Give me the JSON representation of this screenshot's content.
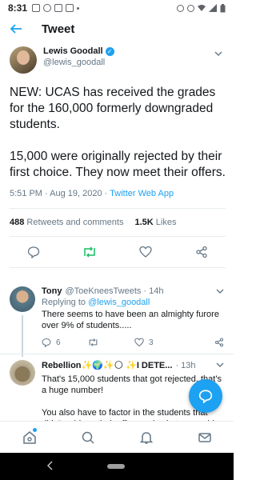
{
  "status_bar": {
    "time": "8:31"
  },
  "app_bar": {
    "title": "Tweet"
  },
  "tweet": {
    "author_name": "Lewis Goodall",
    "author_handle": "@lewis_goodall",
    "text": "NEW: UCAS has received the grades for the 160,000 formerly downgraded students.\n\n15,000 were originally rejected by their first choice. They now meet their offers.",
    "timestamp": "5:51 PM · Aug 19, 2020 · ",
    "source": "Twitter Web App",
    "retweets_count": "488",
    "retweets_label": " Retweets and comments",
    "likes_count": "1.5K",
    "likes_label": " Likes"
  },
  "replies": [
    {
      "name": "Tony",
      "handle": "@ToeKneesTweets",
      "time": "· 14h",
      "replying_prefix": "Replying to ",
      "replying_to": "@lewis_goodall",
      "text": "There seems to have been an almighty furore over 9% of students.....",
      "reply_count": "6",
      "like_count": "3"
    },
    {
      "name": "Rebellion✨🌍✨🌕 ✨I DETE...",
      "time": "· 13h",
      "text": "That's 15,000 students that got rejected, that's a huge number!\n\nYou also have to factor in the students that didn't achieve their offer grades but were able to"
    }
  ],
  "colors": {
    "accent": "#1da1f2",
    "text": "#14171a",
    "muted": "#657786"
  }
}
